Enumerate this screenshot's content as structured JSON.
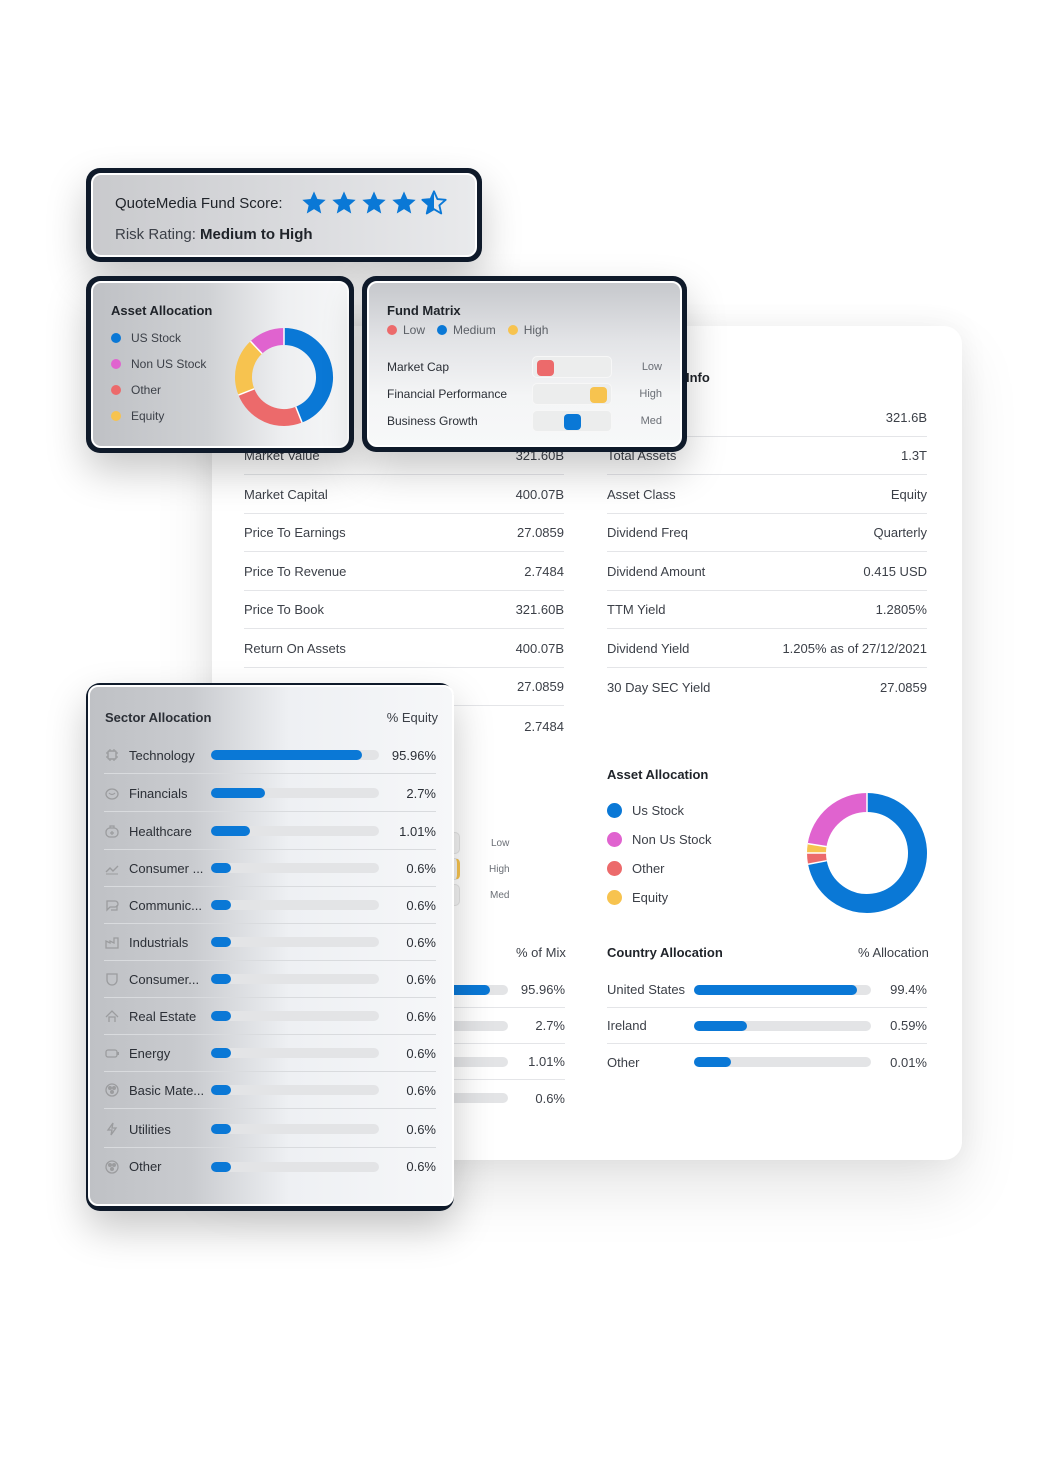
{
  "colors": {
    "accent_blue": "#0a78d6",
    "pink": "#e063cf",
    "red": "#ec6a6b",
    "yellow": "#f7c34f",
    "track": "#e3e4e6",
    "panel_border_dark": "#0f1a2a"
  },
  "fund_score": {
    "label": "QuoteMedia Fund Score:",
    "stars": 4.5,
    "max_stars": 5,
    "risk_label": "Risk Rating:",
    "risk_value": "Medium to High"
  },
  "asset_allocation_small": {
    "title": "Asset Allocation",
    "legend": [
      {
        "label": "US Stock",
        "color": "#0a78d6"
      },
      {
        "label": "Non US Stock",
        "color": "#e063cf"
      },
      {
        "label": "Other",
        "color": "#ec6a6b"
      },
      {
        "label": "Equity",
        "color": "#f7c34f"
      }
    ],
    "slices": [
      {
        "label": "US Stock",
        "value": 44,
        "color": "#0a78d6"
      },
      {
        "label": "Other",
        "value": 25,
        "color": "#ec6a6b"
      },
      {
        "label": "Equity",
        "value": 19,
        "color": "#f7c34f"
      },
      {
        "label": "Non US Stock",
        "value": 12,
        "color": "#e063cf"
      }
    ]
  },
  "fund_matrix": {
    "title": "Fund Matrix",
    "legend": [
      {
        "label": "Low",
        "color": "#ec6a6b"
      },
      {
        "label": "Medium",
        "color": "#0a78d6"
      },
      {
        "label": "High",
        "color": "#f7c34f"
      }
    ],
    "rows": [
      {
        "name": "Market Cap",
        "level": "Low",
        "position": 0,
        "color": "#ec6a6b"
      },
      {
        "name": "Financial Performance",
        "level": "High",
        "position": 1,
        "color": "#f7c34f"
      },
      {
        "name": "Business Growth",
        "level": "Med",
        "position": 0.5,
        "color": "#0a78d6"
      }
    ]
  },
  "info": {
    "title_fragment": "Info",
    "top_value": "321.6B",
    "left": [
      {
        "label": "Market Value",
        "value": "321.60B"
      },
      {
        "label": "Market Capital",
        "value": "400.07B"
      },
      {
        "label": "Price To Earnings",
        "value": "27.0859"
      },
      {
        "label": "Price To Revenue",
        "value": "2.7484"
      },
      {
        "label": "Price To Book",
        "value": "321.60B"
      },
      {
        "label": "Return On Assets",
        "value": "400.07B"
      },
      {
        "label": "",
        "value": "27.0859"
      },
      {
        "label": "",
        "value": "2.7484"
      }
    ],
    "right": [
      {
        "label": "Total Assets",
        "value": "1.3T"
      },
      {
        "label": "Asset Class",
        "value": "Equity"
      },
      {
        "label": "Dividend Freq",
        "value": "Quarterly"
      },
      {
        "label": "Dividend Amount",
        "value": "0.415 USD"
      },
      {
        "label": "TTM Yield",
        "value": "1.2805%"
      },
      {
        "label": "Dividend Yield",
        "value": "1.205% as of 27/12/2021"
      },
      {
        "label": "30 Day SEC Yield",
        "value": "27.0859"
      }
    ]
  },
  "background_matrix_echo": {
    "levels": [
      "Low",
      "High",
      "Med"
    ]
  },
  "mix": {
    "header": "% of Mix",
    "rows": [
      {
        "value": "95.96%",
        "fraction": 0.9596
      },
      {
        "value": "2.7%",
        "fraction": 0.027
      },
      {
        "value": "1.01%",
        "fraction": 0.0101
      },
      {
        "value": "0.6%",
        "fraction": 0.006
      }
    ]
  },
  "asset_allocation_large": {
    "title": "Asset Allocation",
    "legend": [
      {
        "label": "Us Stock",
        "color": "#0a78d6"
      },
      {
        "label": "Non Us Stock",
        "color": "#e063cf"
      },
      {
        "label": "Other",
        "color": "#ec6a6b"
      },
      {
        "label": "Equity",
        "color": "#f7c34f"
      }
    ],
    "slices": [
      {
        "label": "Us Stock",
        "value": 72,
        "color": "#0a78d6"
      },
      {
        "label": "Other",
        "value": 3,
        "color": "#ec6a6b"
      },
      {
        "label": "Equity",
        "value": 2.5,
        "color": "#f7c34f"
      },
      {
        "label": "Non Us Stock",
        "value": 22.5,
        "color": "#e063cf"
      }
    ]
  },
  "country_allocation": {
    "title": "Country Allocation",
    "header": "% Allocation",
    "rows": [
      {
        "name": "United States",
        "value": "99.4%",
        "fill": 0.92
      },
      {
        "name": "Ireland",
        "value": "0.59%",
        "fill": 0.3
      },
      {
        "name": "Other",
        "value": "0.01%",
        "fill": 0.21
      }
    ]
  },
  "sector_allocation": {
    "title": "Sector Allocation",
    "header": "% Equity",
    "rows": [
      {
        "name": "Technology",
        "icon": "chip-icon",
        "value": "95.96%",
        "fill": 0.9
      },
      {
        "name": "Financials",
        "icon": "piggy-bank-icon",
        "value": "2.7%",
        "fill": 0.32
      },
      {
        "name": "Healthcare",
        "icon": "medical-bag-icon",
        "value": "1.01%",
        "fill": 0.23
      },
      {
        "name": "Consumer ...",
        "icon": "trend-icon",
        "value": "0.6%",
        "fill": 0.12
      },
      {
        "name": "Communic...",
        "icon": "chat-icon",
        "value": "0.6%",
        "fill": 0.12
      },
      {
        "name": "Industrials",
        "icon": "factory-icon",
        "value": "0.6%",
        "fill": 0.12
      },
      {
        "name": "Consumer...",
        "icon": "shield-icon",
        "value": "0.6%",
        "fill": 0.12
      },
      {
        "name": "Real Estate",
        "icon": "house-icon",
        "value": "0.6%",
        "fill": 0.12
      },
      {
        "name": "Energy",
        "icon": "battery-icon",
        "value": "0.6%",
        "fill": 0.12
      },
      {
        "name": "Basic Mate...",
        "icon": "atom-icon",
        "value": "0.6%",
        "fill": 0.12
      },
      {
        "name": "Utilities",
        "icon": "plug-icon",
        "value": "0.6%",
        "fill": 0.12
      },
      {
        "name": "Other",
        "icon": "atom-icon",
        "value": "0.6%",
        "fill": 0.12
      }
    ]
  }
}
